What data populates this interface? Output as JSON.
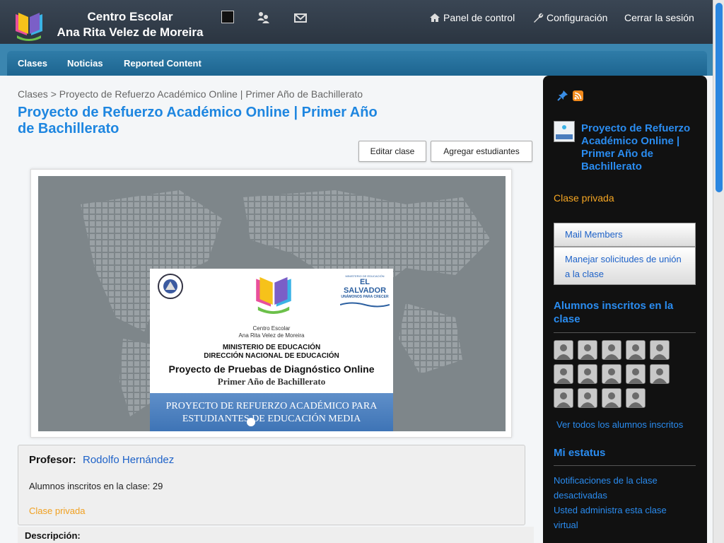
{
  "header": {
    "school_line1": "Centro Escolar",
    "school_line2": "Ana Rita Velez de Moreira",
    "dashboard": "Panel de control",
    "settings": "Configuración",
    "logout": "Cerrar la sesión"
  },
  "nav": {
    "items": [
      "Clases",
      "Noticias",
      "Reported Content"
    ]
  },
  "breadcrumb": {
    "root": "Clases",
    "separator": ">",
    "current": "Proyecto de Refuerzo Académico Online | Primer Año de Bachillerato"
  },
  "page": {
    "title": "Proyecto de Refuerzo Académico Online | Primer Año de Bachillerato",
    "edit_button": "Editar clase",
    "add_students_button": "Agregar estudiantes"
  },
  "banner": {
    "school_line1": "Centro Escolar",
    "school_line2": "Ana Rita Velez de Moreira",
    "ministry_line1": "MINISTERIO DE EDUCACIÓN",
    "ministry_line2": "DIRECCIÓN NACIONAL DE EDUCACIÓN",
    "project": "Proyecto de Pruebas de Diagnóstico Online",
    "year": "Primer Año de Bachillerato",
    "strip_line1": "PROYECTO DE REFUERZO ACADÉMICO PARA",
    "strip_line2": "ESTUDIANTES DE EDUCACIÓN MEDIA",
    "logo_small_top": "MINISTERIO DE EDUCACIÓN",
    "logo_country": "EL SALVADOR",
    "logo_motto": "UNÁMONOS PARA CRECER"
  },
  "info": {
    "teacher_label": "Profesor:",
    "teacher_name": "Rodolfo Hernández",
    "enrolled": "Alumnos inscritos en la clase: 29",
    "privacy": "Clase privada",
    "description_label": "Descripción:"
  },
  "sidebar": {
    "class_title": "Proyecto de Refuerzo Académico Online | Primer Año de Bachillerato",
    "privacy": "Clase privada",
    "mail_members": "Mail Members",
    "manage_requests": "Manejar solicitudes de unión a la clase",
    "students_heading": "Alumnos inscritos en la clase",
    "student_avatar_count": 14,
    "view_all": "Ver todos los alumnos inscritos",
    "status_heading": "Mi estatus",
    "status_link1": "Notificaciones de la clase desactivadas",
    "status_link2": "Usted administra esta clase virtual"
  },
  "colors": {
    "accent": "#1e86e0",
    "private": "#f5a623",
    "header_bg": "#2b3541",
    "nav_bg": "#1d6590"
  }
}
